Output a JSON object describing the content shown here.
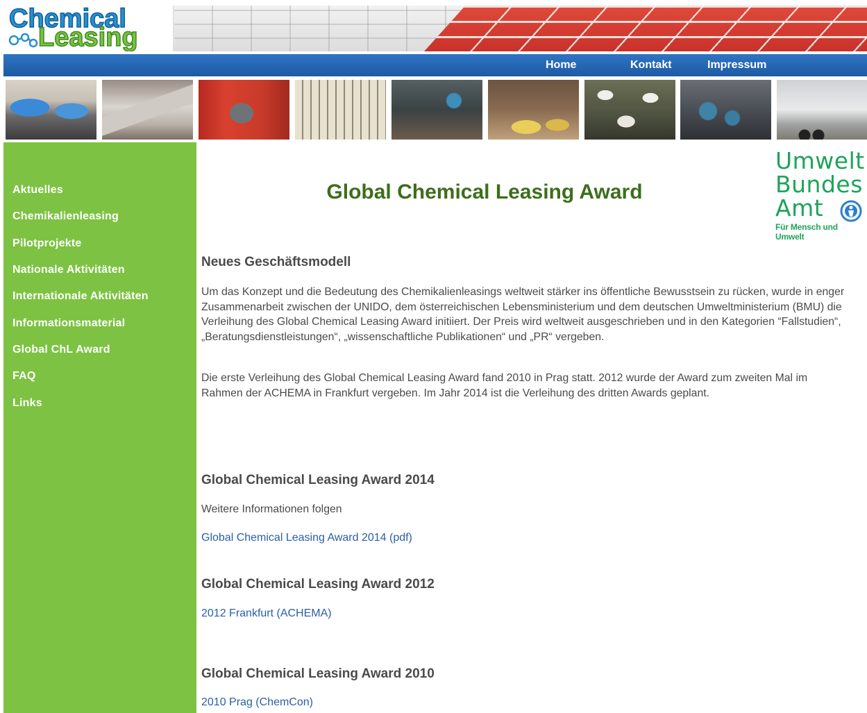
{
  "header": {
    "logo_line1": "Chemical",
    "logo_line2": "Leasing"
  },
  "nav": {
    "items": [
      {
        "label": "Home"
      },
      {
        "label": "Kontakt"
      },
      {
        "label": "Impressum"
      }
    ]
  },
  "sidebar": {
    "items": [
      {
        "label": "Aktuelles"
      },
      {
        "label": "Chemikalienleasing"
      },
      {
        "label": "Pilotprojekte"
      },
      {
        "label": "Nationale Aktivitäten"
      },
      {
        "label": "Internationale Aktivitäten"
      },
      {
        "label": "Informationsmaterial"
      },
      {
        "label": "Global ChL Award"
      },
      {
        "label": "FAQ"
      },
      {
        "label": "Links"
      }
    ]
  },
  "uba_logo": {
    "line1": "Umwelt",
    "line2": "Bundes",
    "line3": "Amt",
    "tagline": "Für Mensch und Umwelt"
  },
  "main": {
    "title": "Global Chemical Leasing Award",
    "intro_heading": "Neues Geschäftsmodell",
    "intro_p1": "Um das Konzept und die Bedeutung des Chemikalienleasings weltweit stärker ins öffentliche Bewusstsein zu rücken, wurde in enger Zusammenarbeit zwischen der UNIDO, dem österreichischen Lebensministerium und dem deutschen Umweltministerium (BMU) die Verleihung des Global Chemical Leasing Award initiiert. Der Preis wird weltweit ausgeschrieben und in den Kategorien “Fallstudien“, „Beratungsdienstleistungen“, „wissenschaftliche Publikationen“ und „PR“ vergeben.",
    "intro_p2": "Die erste Verleihung des Global Chemical Leasing Award fand 2010 in Prag statt. 2012 wurde der Award zum zweiten Mal im Rahmen der ACHEMA in Frankfurt vergeben. Im Jahr 2014 ist die Verleihung des dritten Awards geplant.",
    "award2014": {
      "heading": "Global Chemical Leasing Award 2014",
      "text": "Weitere Informationen folgen",
      "link": "Global Chemical Leasing Award 2014 (pdf)"
    },
    "award2012": {
      "heading": "Global Chemical Leasing Award 2012",
      "link": "2012 Frankfurt (ACHEMA)"
    },
    "award2010": {
      "heading": "Global Chemical Leasing Award 2010",
      "link": "2010 Prag (ChemCon)"
    }
  },
  "colors": {
    "sidebar_green": "#7dc242",
    "nav_blue": "#2066b0",
    "title_green": "#3d6e1b",
    "link_blue": "#2a5ea6",
    "uba_green": "#1ea35b"
  }
}
